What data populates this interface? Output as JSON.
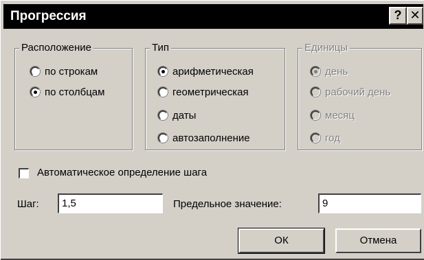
{
  "window": {
    "title": "Прогрессия",
    "help_glyph": "?",
    "close_glyph": "✕"
  },
  "placement": {
    "label": "Расположение",
    "options": [
      {
        "label": "по строкам",
        "selected": false
      },
      {
        "label": "по столбцам",
        "selected": true
      }
    ]
  },
  "type": {
    "label": "Тип",
    "options": [
      {
        "label": "арифметическая",
        "selected": true
      },
      {
        "label": "геометрическая",
        "selected": false
      },
      {
        "label": "даты",
        "selected": false
      },
      {
        "label": "автозаполнение",
        "selected": false
      }
    ]
  },
  "units": {
    "label": "Единицы",
    "disabled": true,
    "options": [
      {
        "label": "день",
        "selected": true
      },
      {
        "label": "рабочий день",
        "selected": false
      },
      {
        "label": "месяц",
        "selected": false
      },
      {
        "label": "год",
        "selected": false
      }
    ]
  },
  "auto_step": {
    "label": "Автоматическое определение шага",
    "checked": false
  },
  "step": {
    "label": "Шаг:",
    "value": "1,5"
  },
  "limit": {
    "label": "Предельное значение:",
    "value": "9"
  },
  "buttons": {
    "ok": "ОК",
    "cancel": "Отмена"
  },
  "colors": {
    "dialog_face": "#d4d0c8",
    "titlebar": "#000000",
    "disabled_text": "#808080"
  }
}
